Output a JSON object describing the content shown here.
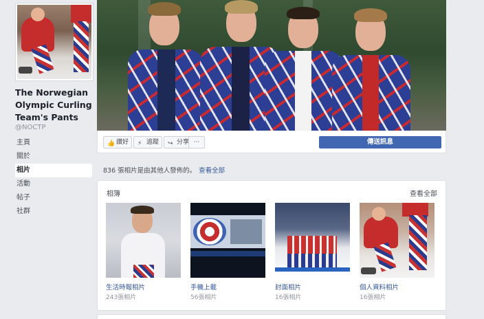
{
  "page": {
    "name": "The Norwegian Olympic Curling Team's Pants",
    "handle": "@NOCTP"
  },
  "nav": {
    "items": [
      {
        "label": "主頁"
      },
      {
        "label": "關於"
      },
      {
        "label": "相片",
        "active": true
      },
      {
        "label": "活動"
      },
      {
        "label": "帖子"
      },
      {
        "label": "社群"
      }
    ]
  },
  "actions": {
    "like_label": "讚好",
    "follow_label": "追蹤",
    "share_label": "分享",
    "more_label": "···",
    "send_message_label": "傳送訊息"
  },
  "photos": {
    "note": "836 張相片是由其他人發佈的。",
    "see_all": "查看全部"
  },
  "albums": {
    "title": "相簿",
    "see_all": "查看全部",
    "items": [
      {
        "name": "生活時報相片",
        "count": "243張相片"
      },
      {
        "name": "手機上載",
        "count": "56張相片"
      },
      {
        "name": "封面相片",
        "count": "16張相片"
      },
      {
        "name": "個人資料相片",
        "count": "16張相片"
      }
    ]
  },
  "colors": {
    "accent": "#4267b2",
    "link": "#365899",
    "background": "#e9ebee"
  }
}
